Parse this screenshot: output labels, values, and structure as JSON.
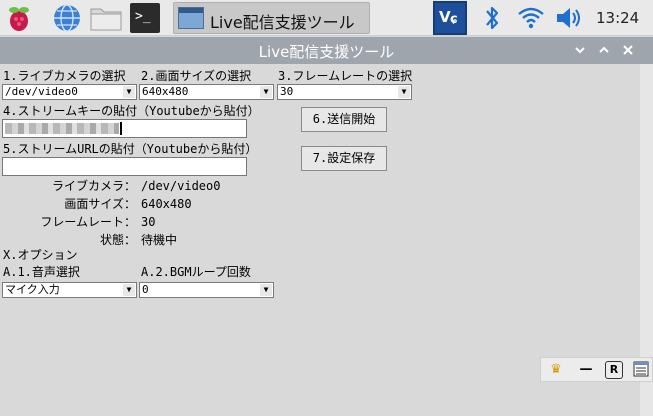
{
  "taskbar": {
    "task_label": "Live配信支援ツール",
    "time": "13:24",
    "icons": [
      "raspberry-icon",
      "globe-icon",
      "folder-icon",
      "terminal-icon",
      "vnc-icon",
      "bluetooth-icon",
      "wifi-icon",
      "volume-icon"
    ],
    "terminal_glyph": ">_"
  },
  "window": {
    "title": "Live配信支援ツール",
    "controls": [
      "⌄",
      "⌃",
      "✕"
    ]
  },
  "form": {
    "camera_label": "1.ライブカメラの選択",
    "camera_value": "/dev/video0",
    "size_label": "2.画面サイズの選択",
    "size_value": "640x480",
    "fps_label": "3.フレームレートの選択",
    "fps_value": "30",
    "key_label": "4.ストリームキーの貼付（Youtubeから貼付）",
    "key_value": "",
    "url_label": "5.ストリームURLの貼付（Youtubeから貼付）",
    "url_value": "",
    "send_button": "6.送信開始",
    "save_button": "7.設定保存"
  },
  "status": {
    "camera_caption": "ライブカメラ：",
    "camera_value": "/dev/video0",
    "size_caption": "画面サイズ：",
    "size_value": "640x480",
    "fps_caption": "フレームレート：",
    "fps_value": "30",
    "state_caption": "状態：",
    "state_value": "待機中"
  },
  "options": {
    "section": "X.オプション",
    "audio_label": "A.1.音声選択",
    "audio_value": "マイク入力",
    "bgm_label": "A.2.BGMループ回数",
    "bgm_value": "0"
  },
  "tray": {
    "r_label": "R",
    "minus_label": "—"
  },
  "colors": {
    "titlebar": "#9fa5ad",
    "client": "#d9d9d9",
    "accent_blue": "#1f6fd1"
  }
}
